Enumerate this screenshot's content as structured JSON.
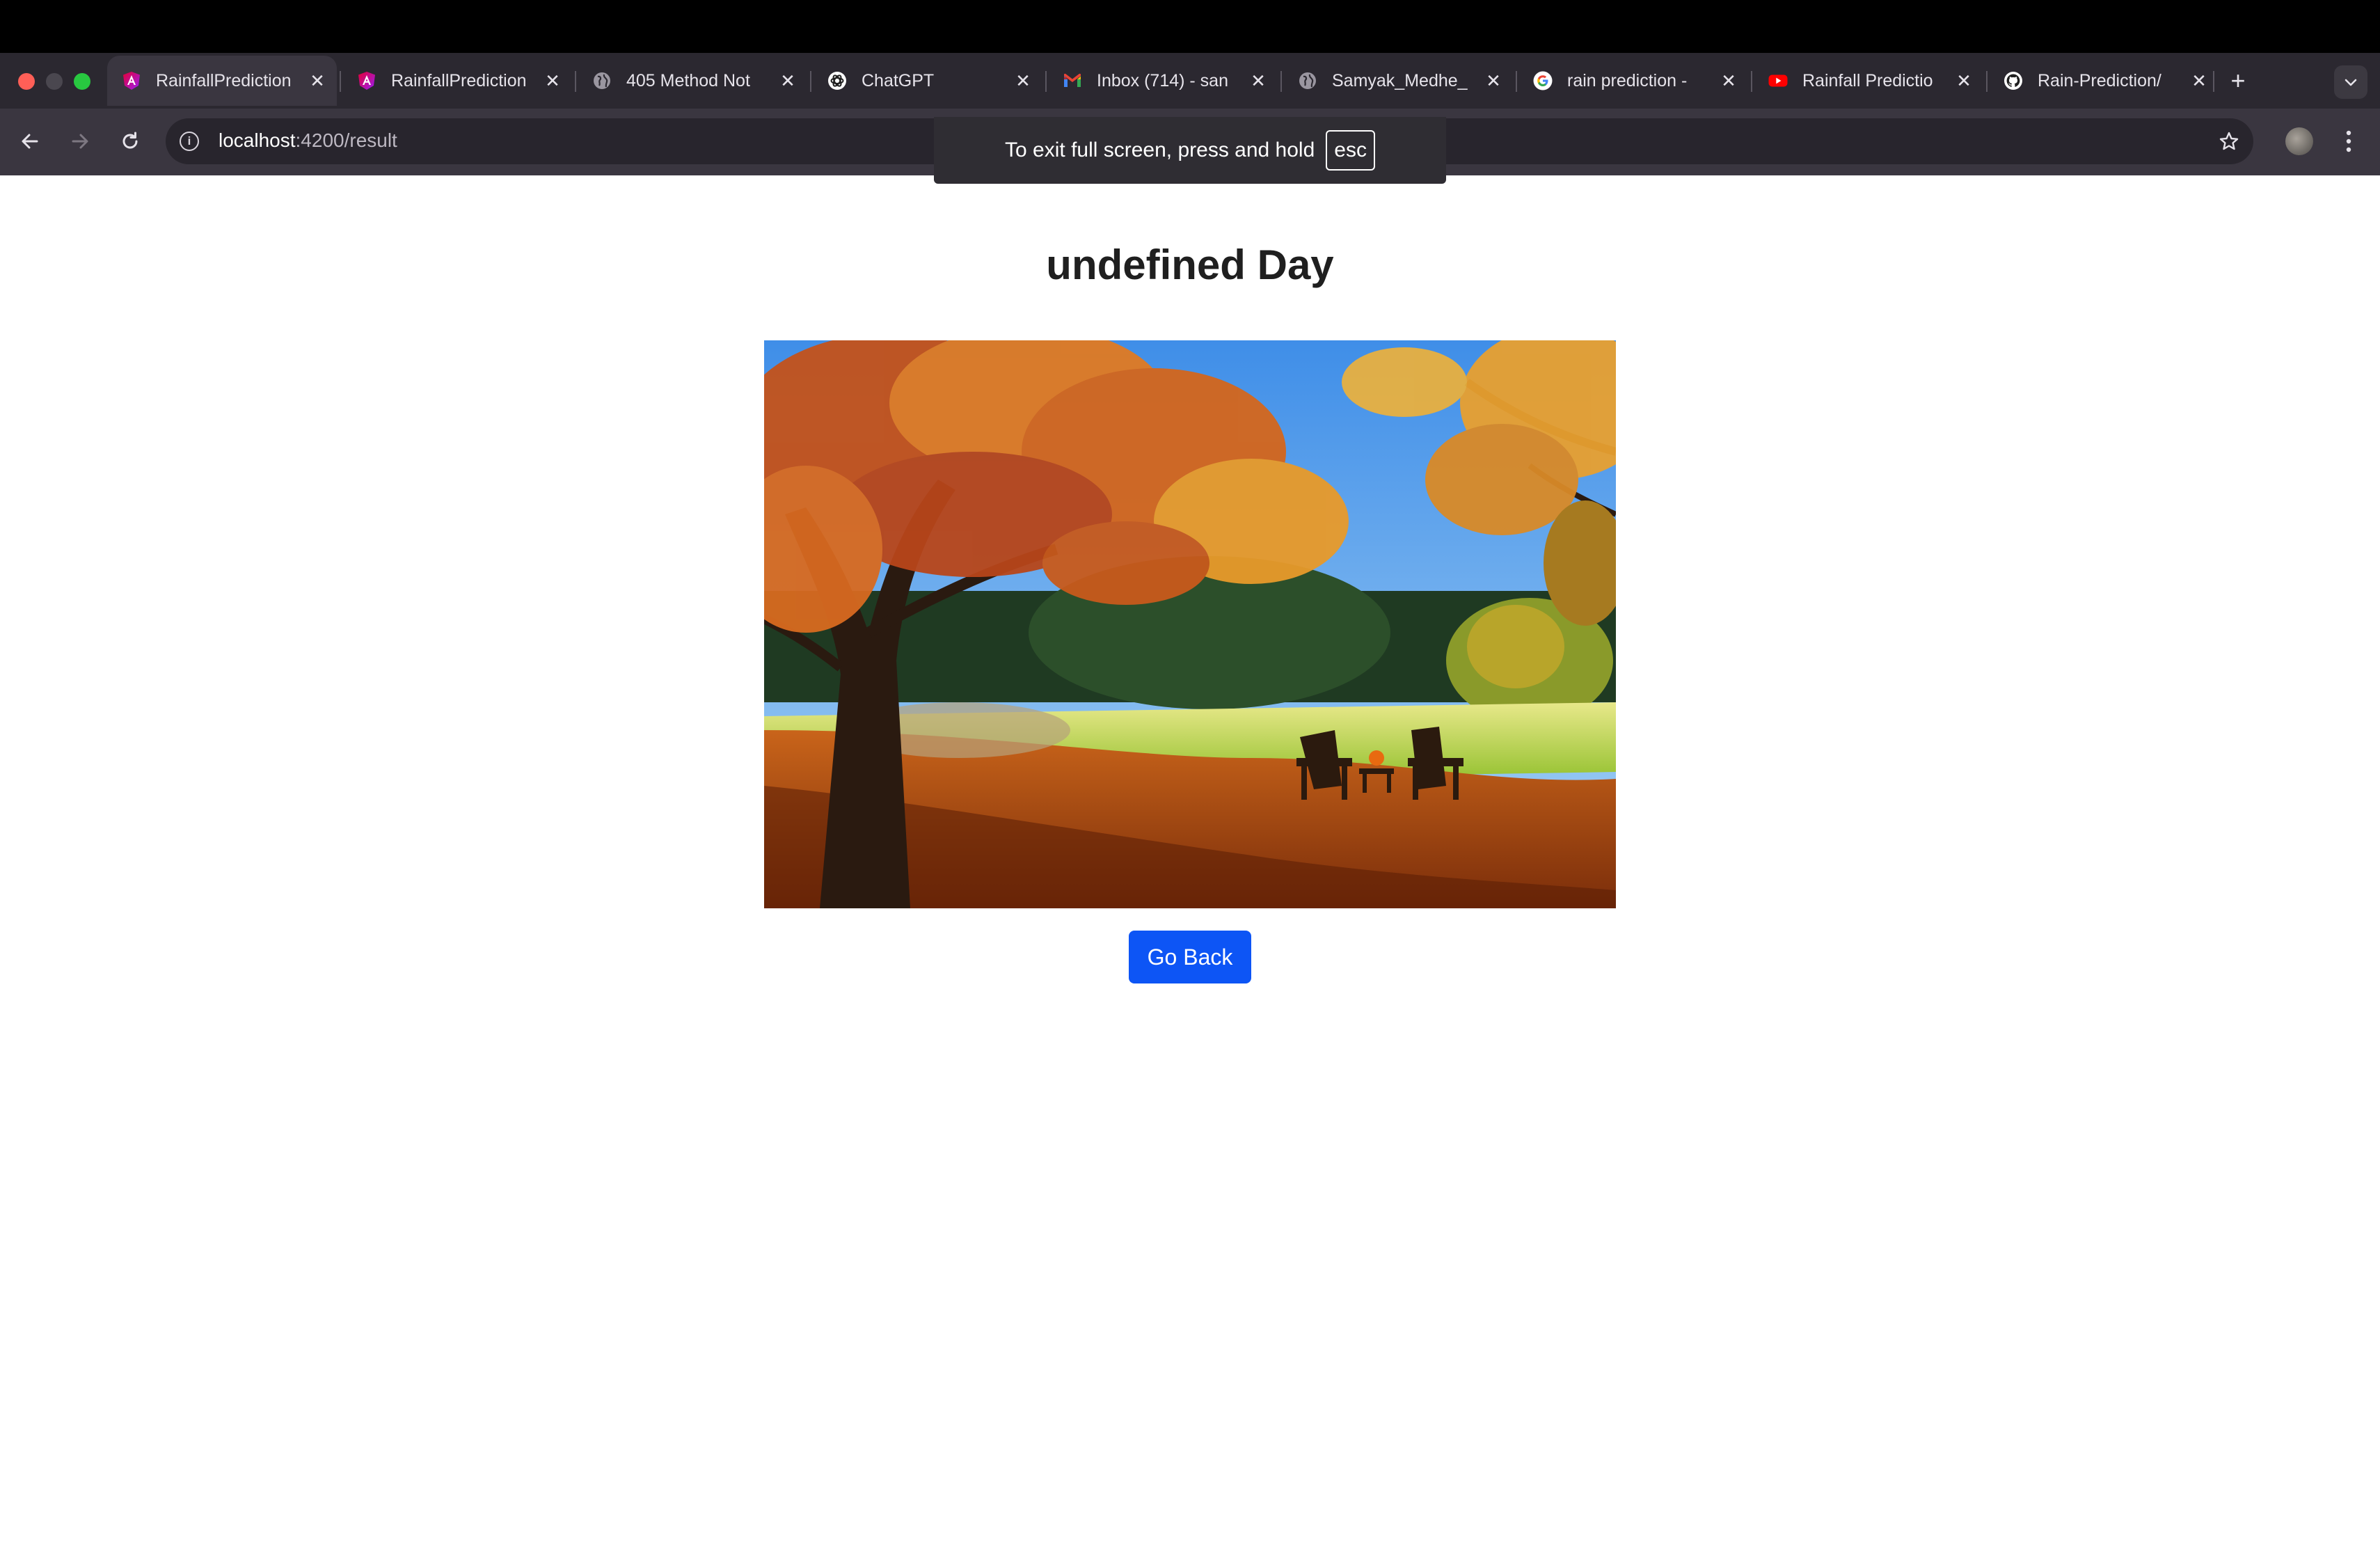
{
  "browser": {
    "tabs": [
      {
        "label": "RainfallPrediction",
        "icon": "angular-icon",
        "active": true
      },
      {
        "label": "RainfallPrediction",
        "icon": "angular-icon",
        "active": false
      },
      {
        "label": "405 Method Not",
        "icon": "globe-icon",
        "active": false
      },
      {
        "label": "ChatGPT",
        "icon": "openai-icon",
        "active": false
      },
      {
        "label": "Inbox (714) - san",
        "icon": "gmail-icon",
        "active": false
      },
      {
        "label": "Samyak_Medhe_",
        "icon": "globe-icon",
        "active": false
      },
      {
        "label": "rain prediction - ",
        "icon": "google-icon",
        "active": false
      },
      {
        "label": "Rainfall Predictio",
        "icon": "youtube-icon",
        "active": false
      },
      {
        "label": "Rain-Prediction/",
        "icon": "github-icon",
        "active": false
      }
    ],
    "close_glyph": "✕",
    "new_tab_glyph": "+",
    "address": {
      "host": "localhost",
      "path": ":4200/result"
    },
    "fullscreen_notice": {
      "text": "To exit full screen, press and hold",
      "key": "esc"
    }
  },
  "page": {
    "heading": "undefined Day",
    "image_alt": "autumn trees with two adirondack chairs",
    "go_back_label": "Go Back",
    "accent_color": "#0d55f5"
  }
}
